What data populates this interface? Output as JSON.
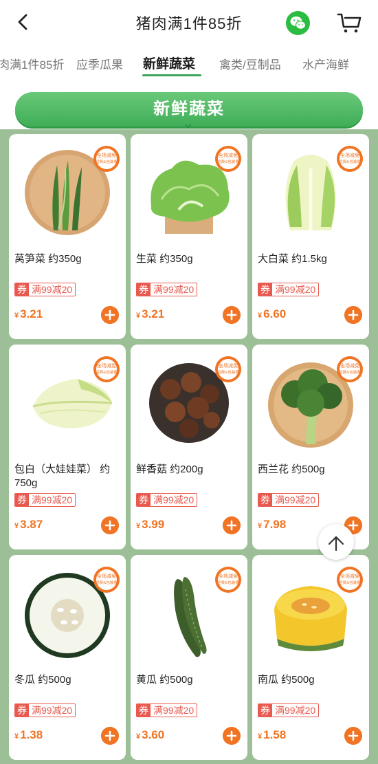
{
  "header": {
    "title": "猪肉满1件85折"
  },
  "tabs": [
    "肉满1件85折",
    "应季瓜果",
    "新鲜蔬菜",
    "禽类/豆制品",
    "水产海鲜"
  ],
  "active_tab": "新鲜蔬菜",
  "section": {
    "title": "新鲜蔬菜"
  },
  "badge_text": {
    "line1": "全场减免",
    "line2": "运费&包装费"
  },
  "products": [
    {
      "name": "莴笋菜 约350g",
      "coupon_tag": "券",
      "coupon_text": "满99减20",
      "currency": "¥",
      "price": "3.21",
      "icon": "lettuce-stem-icon"
    },
    {
      "name": "生菜 约350g",
      "coupon_tag": "券",
      "coupon_text": "满99减20",
      "currency": "¥",
      "price": "3.21",
      "icon": "lettuce-icon"
    },
    {
      "name": "大白菜 约1.5kg",
      "coupon_tag": "券",
      "coupon_text": "满99减20",
      "currency": "¥",
      "price": "6.60",
      "icon": "napa-cabbage-icon"
    },
    {
      "name": "包白（大娃娃菜） 约750g",
      "coupon_tag": "券",
      "coupon_text": "满99减20",
      "currency": "¥",
      "price": "3.87",
      "icon": "baby-cabbage-icon"
    },
    {
      "name": "鲜香菇 约200g",
      "coupon_tag": "券",
      "coupon_text": "满99减20",
      "currency": "¥",
      "price": "3.99",
      "icon": "shiitake-icon"
    },
    {
      "name": "西兰花 约500g",
      "coupon_tag": "券",
      "coupon_text": "满99减20",
      "currency": "¥",
      "price": "7.98",
      "icon": "broccoli-icon"
    },
    {
      "name": "冬瓜 约500g",
      "coupon_tag": "券",
      "coupon_text": "满99减20",
      "currency": "¥",
      "price": "1.38",
      "icon": "winter-melon-icon"
    },
    {
      "name": "黄瓜 约500g",
      "coupon_tag": "券",
      "coupon_text": "满99减20",
      "currency": "¥",
      "price": "3.60",
      "icon": "cucumber-icon"
    },
    {
      "name": "南瓜 约500g",
      "coupon_tag": "券",
      "coupon_text": "满99减20",
      "currency": "¥",
      "price": "1.58",
      "icon": "pumpkin-icon"
    }
  ],
  "colors": {
    "accent_green": "#3fae57",
    "price_orange": "#f07424",
    "coupon_red": "#e85a4f",
    "grid_bg": "#9cbf97"
  }
}
